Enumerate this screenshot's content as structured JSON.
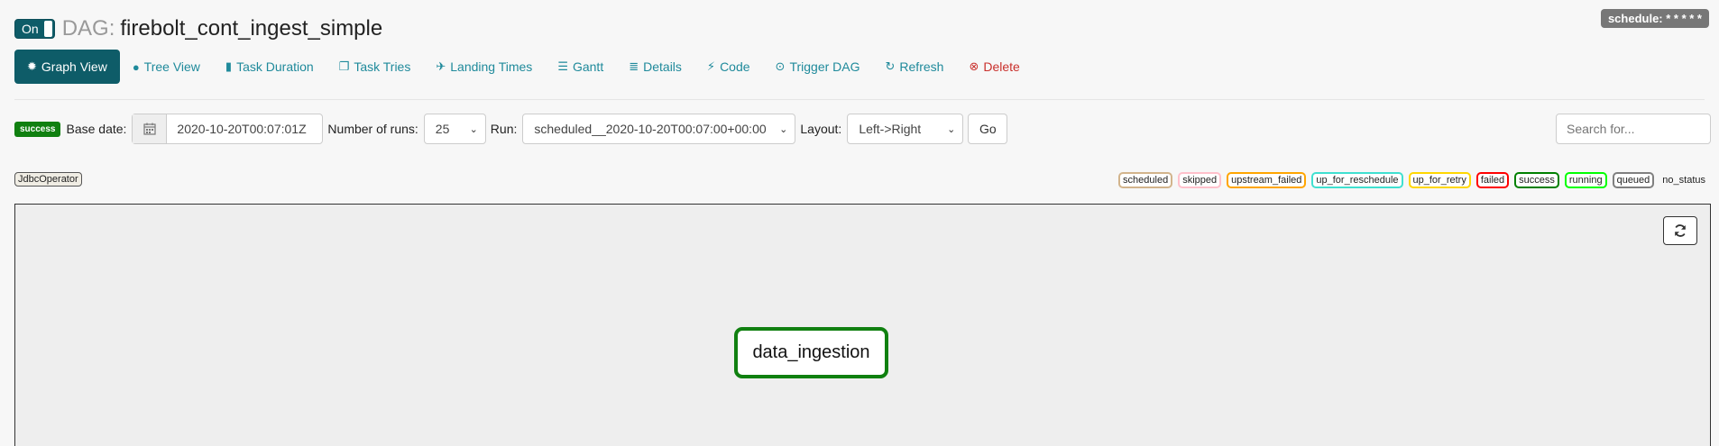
{
  "header": {
    "toggle_label": "On",
    "title_prefix": "DAG:",
    "dag_id": "firebolt_cont_ingest_simple",
    "schedule": "schedule: * * * * *"
  },
  "nav": {
    "items": [
      {
        "label": "Graph View",
        "icon": "graph-icon",
        "active": true
      },
      {
        "label": "Tree View",
        "icon": "tree-icon"
      },
      {
        "label": "Task Duration",
        "icon": "bar-chart-icon"
      },
      {
        "label": "Task Tries",
        "icon": "copy-icon"
      },
      {
        "label": "Landing Times",
        "icon": "plane-icon"
      },
      {
        "label": "Gantt",
        "icon": "align-left-icon"
      },
      {
        "label": "Details",
        "icon": "list-icon"
      },
      {
        "label": "Code",
        "icon": "bolt-icon"
      },
      {
        "label": "Trigger DAG",
        "icon": "play-circle-icon"
      },
      {
        "label": "Refresh",
        "icon": "refresh-icon"
      },
      {
        "label": "Delete",
        "icon": "remove-circle-icon"
      }
    ]
  },
  "form": {
    "state": "success",
    "base_date_label": "Base date:",
    "base_date": "2020-10-20T00:07:01Z",
    "num_runs_label": "Number of runs:",
    "num_runs": "25",
    "run_label": "Run:",
    "run": "scheduled__2020-10-20T00:07:00+00:00",
    "layout_label": "Layout:",
    "layout": "Left->Right",
    "go_label": "Go",
    "search_placeholder": "Search for..."
  },
  "operators": [
    "JdbcOperator"
  ],
  "legend": [
    {
      "label": "scheduled",
      "color": "#d2b48c"
    },
    {
      "label": "skipped",
      "color": "#ffc0cb"
    },
    {
      "label": "upstream_failed",
      "color": "#ffa500"
    },
    {
      "label": "up_for_reschedule",
      "color": "#40e0d0"
    },
    {
      "label": "up_for_retry",
      "color": "#ffd700"
    },
    {
      "label": "failed",
      "color": "#ff0000"
    },
    {
      "label": "success",
      "color": "#008000"
    },
    {
      "label": "running",
      "color": "#00ff00"
    },
    {
      "label": "queued",
      "color": "#808080"
    },
    {
      "label": "no_status",
      "color": null
    }
  ],
  "graph": {
    "nodes": [
      {
        "label": "data_ingestion",
        "state": "success"
      }
    ]
  }
}
